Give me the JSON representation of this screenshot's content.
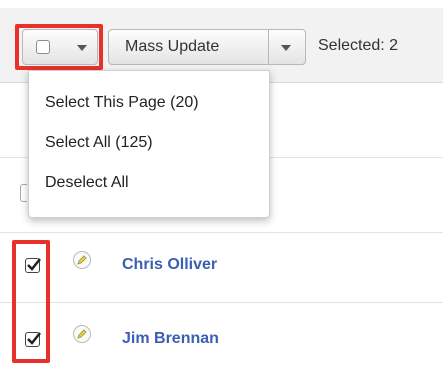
{
  "toolbar": {
    "select_icon": "checkbox-dropdown",
    "mass_update_label": "Mass Update",
    "selected_text": "Selected: 2"
  },
  "select_menu": {
    "items": [
      {
        "label": "Select This Page (20)"
      },
      {
        "label": "Select All (125)"
      },
      {
        "label": "Deselect All"
      }
    ]
  },
  "rows": [
    {
      "name": "Chris Olliver",
      "checked": true
    },
    {
      "name": "Jim Brennan",
      "checked": true
    }
  ],
  "colors": {
    "highlight": "#e8312b",
    "link": "#3b5fb3"
  }
}
